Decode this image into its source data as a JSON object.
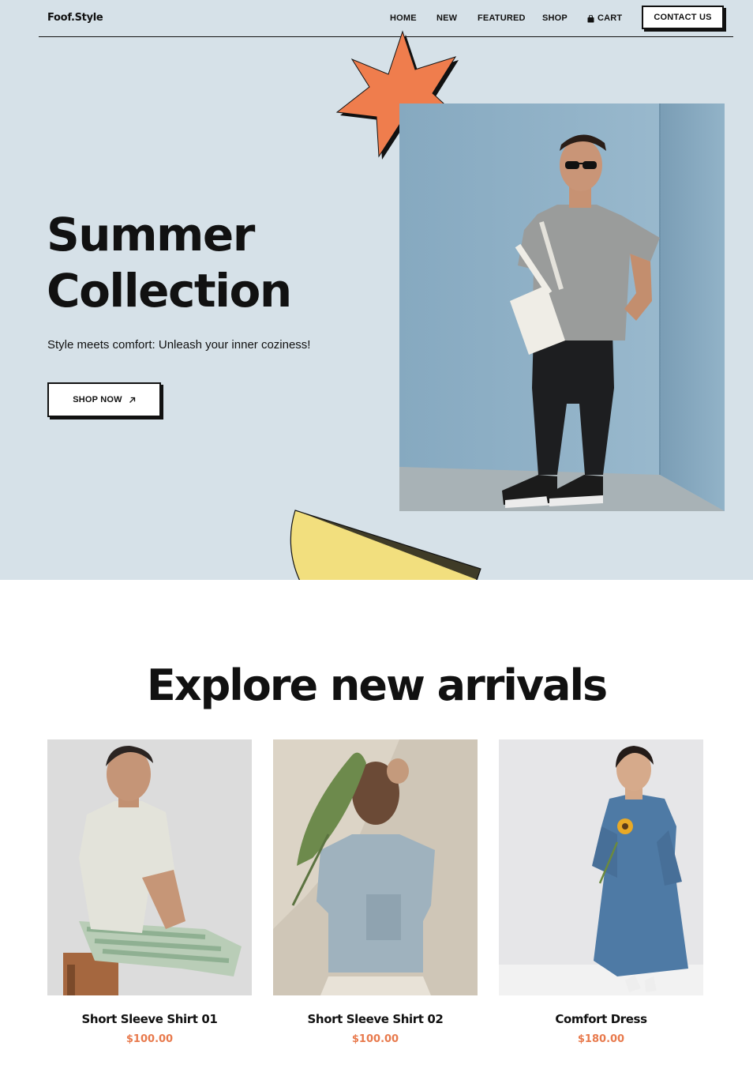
{
  "brand": {
    "logo": "Foof.Style"
  },
  "nav": {
    "items": [
      "HOME",
      "NEW",
      "FEATURED",
      "SHOP"
    ],
    "cart_label": "CART",
    "contact_label": "CONTACT US"
  },
  "hero": {
    "title_line1": "Summer",
    "title_line2": "Collection",
    "subtitle": "Style meets comfort: Unleash your inner coziness!",
    "cta_label": "SHOP NOW",
    "cta_icon": "arrow-up-right-icon"
  },
  "arrivals": {
    "title": "Explore new arrivals",
    "products": [
      {
        "name": "Short Sleeve Shirt 01",
        "price": "$100.00"
      },
      {
        "name": "Short Sleeve Shirt 02",
        "price": "$100.00"
      },
      {
        "name": "Comfort Dress",
        "price": "$180.00"
      }
    ]
  },
  "colors": {
    "hero_bg": "#d6e1e8",
    "accent_orange": "#ef7d4d",
    "accent_yellow": "#f2df7e",
    "price": "#e87a4d",
    "ink": "#111111"
  }
}
